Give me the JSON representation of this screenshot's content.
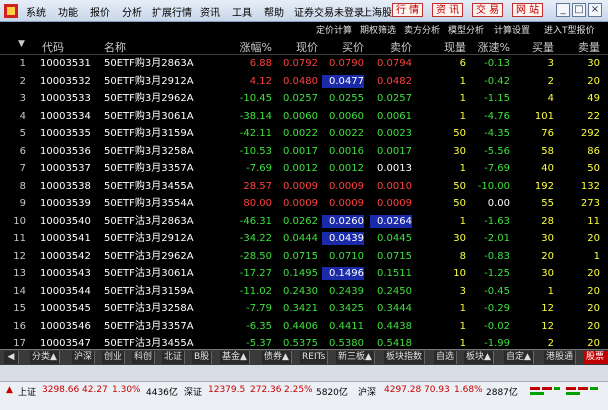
{
  "menubar": {
    "items": [
      "系统",
      "功能",
      "报价",
      "分析",
      "扩展行情",
      "资讯",
      "工具",
      "帮助"
    ],
    "login_status": "证券交易未登录",
    "market": "上海股",
    "buttons": [
      "行 情",
      "资 讯",
      "交 易",
      "网 站"
    ],
    "window_controls": [
      "_",
      "□",
      "×"
    ]
  },
  "subbar": {
    "items": [
      "定价计算",
      "期权筛选",
      "卖方分析",
      "模型分析",
      "计算设置"
    ],
    "right": "进入T型报价"
  },
  "columns": [
    "",
    "代码",
    "名称",
    "涨幅%",
    "现价",
    "买价",
    "卖价",
    "现量",
    "涨速%",
    "买量",
    "卖量"
  ],
  "rows": [
    {
      "n": "1",
      "code": "10003531",
      "name": "50ETF购3月2863A",
      "chg": "6.88",
      "price": "0.0792",
      "bid": "0.0790",
      "ask": "0.0794",
      "vol": "6",
      "speed": "-0.13",
      "bidv": "3",
      "askv": "30",
      "dir": "up"
    },
    {
      "n": "2",
      "code": "10003532",
      "name": "50ETF购3月2912A",
      "chg": "4.12",
      "price": "0.0480",
      "bid": "0.0477",
      "ask": "0.0482",
      "vol": "1",
      "speed": "-0.42",
      "bidv": "2",
      "askv": "20",
      "dir": "up"
    },
    {
      "n": "3",
      "code": "10003533",
      "name": "50ETF购3月2962A",
      "chg": "-10.45",
      "price": "0.0257",
      "bid": "0.0255",
      "ask": "0.0257",
      "vol": "1",
      "speed": "-1.15",
      "bidv": "4",
      "askv": "49",
      "dir": "down"
    },
    {
      "n": "4",
      "code": "10003534",
      "name": "50ETF购3月3061A",
      "chg": "-38.14",
      "price": "0.0060",
      "bid": "0.0060",
      "ask": "0.0061",
      "vol": "1",
      "speed": "-4.76",
      "bidv": "101",
      "askv": "22",
      "dir": "down"
    },
    {
      "n": "5",
      "code": "10003535",
      "name": "50ETF购3月3159A",
      "chg": "-42.11",
      "price": "0.0022",
      "bid": "0.0022",
      "ask": "0.0023",
      "vol": "50",
      "speed": "-4.35",
      "bidv": "76",
      "askv": "292",
      "dir": "down"
    },
    {
      "n": "6",
      "code": "10003536",
      "name": "50ETF购3月3258A",
      "chg": "-10.53",
      "price": "0.0017",
      "bid": "0.0016",
      "ask": "0.0017",
      "vol": "30",
      "speed": "-5.56",
      "bidv": "58",
      "askv": "86",
      "dir": "down"
    },
    {
      "n": "7",
      "code": "10003537",
      "name": "50ETF购3月3357A",
      "chg": "-7.69",
      "price": "0.0012",
      "bid": "0.0012",
      "ask": "0.0013",
      "vol": "1",
      "speed": "-7.69",
      "bidv": "40",
      "askv": "50",
      "dir": "down"
    },
    {
      "n": "8",
      "code": "10003538",
      "name": "50ETF购3月3455A",
      "chg": "28.57",
      "price": "0.0009",
      "bid": "0.0009",
      "ask": "0.0010",
      "vol": "50",
      "speed": "-10.00",
      "bidv": "192",
      "askv": "132",
      "dir": "up"
    },
    {
      "n": "9",
      "code": "10003539",
      "name": "50ETF购3月3554A",
      "chg": "80.00",
      "price": "0.0009",
      "bid": "0.0009",
      "ask": "0.0009",
      "vol": "50",
      "speed": "0.00",
      "bidv": "55",
      "askv": "273",
      "dir": "up"
    },
    {
      "n": "10",
      "code": "10003540",
      "name": "50ETF沽3月2863A",
      "chg": "-46.31",
      "price": "0.0262",
      "bid": "0.0260",
      "ask": "0.0264",
      "vol": "1",
      "speed": "-1.63",
      "bidv": "28",
      "askv": "11",
      "dir": "down"
    },
    {
      "n": "11",
      "code": "10003541",
      "name": "50ETF沽3月2912A",
      "chg": "-34.22",
      "price": "0.0444",
      "bid": "0.0439",
      "ask": "0.0445",
      "vol": "30",
      "speed": "-2.01",
      "bidv": "30",
      "askv": "20",
      "dir": "down"
    },
    {
      "n": "12",
      "code": "10003542",
      "name": "50ETF沽3月2962A",
      "chg": "-28.50",
      "price": "0.0715",
      "bid": "0.0710",
      "ask": "0.0715",
      "vol": "8",
      "speed": "-0.83",
      "bidv": "20",
      "askv": "1",
      "dir": "down"
    },
    {
      "n": "13",
      "code": "10003543",
      "name": "50ETF沽3月3061A",
      "chg": "-17.27",
      "price": "0.1495",
      "bid": "0.1496",
      "ask": "0.1511",
      "vol": "10",
      "speed": "-1.25",
      "bidv": "30",
      "askv": "20",
      "dir": "down"
    },
    {
      "n": "14",
      "code": "10003544",
      "name": "50ETF沽3月3159A",
      "chg": "-11.02",
      "price": "0.2430",
      "bid": "0.2439",
      "ask": "0.2450",
      "vol": "3",
      "speed": "-0.45",
      "bidv": "1",
      "askv": "20",
      "dir": "down"
    },
    {
      "n": "15",
      "code": "10003545",
      "name": "50ETF沽3月3258A",
      "chg": "-7.79",
      "price": "0.3421",
      "bid": "0.3425",
      "ask": "0.3444",
      "vol": "1",
      "speed": "-0.29",
      "bidv": "12",
      "askv": "20",
      "dir": "down"
    },
    {
      "n": "16",
      "code": "10003546",
      "name": "50ETF沽3月3357A",
      "chg": "-6.35",
      "price": "0.4406",
      "bid": "0.4411",
      "ask": "0.4438",
      "vol": "1",
      "speed": "-0.02",
      "bidv": "12",
      "askv": "20",
      "dir": "down"
    },
    {
      "n": "17",
      "code": "10003547",
      "name": "50ETF沽3月3455A",
      "chg": "-5.37",
      "price": "0.5375",
      "bid": "0.5380",
      "ask": "0.5418",
      "vol": "1",
      "speed": "-1.99",
      "bidv": "2",
      "askv": "20",
      "dir": "down"
    }
  ],
  "tabs": [
    "分类▲",
    "沪深",
    "创业",
    "科创",
    "北证",
    "B股",
    "基金▲",
    "债券▲",
    "REITs",
    "新三板▲",
    "板块指数",
    "自选",
    "板块▲",
    "自定▲",
    "港股通",
    "股票"
  ],
  "status": {
    "sh_label": "上证",
    "sh_value": "3298.66",
    "sh_change": "42.27",
    "sh_pct": "1.30%",
    "sh_amount": "4436亿",
    "sz_label": "深证",
    "sz_value": "12379.5",
    "sz_change": "272.36",
    "sz_pct": "2.25%",
    "sz_amount": "5820亿",
    "hs_label": "沪深",
    "hs_value": "4297.28",
    "hs_change": "70.93",
    "hs_pct": "1.68%",
    "hs_amount": "2887亿"
  },
  "colors": {
    "up": "#ff4040",
    "down": "#40e040",
    "neutral": "#ffffff",
    "code": "#ffffff",
    "vol": "#ffff40",
    "highlight": "#1a2aa8"
  }
}
